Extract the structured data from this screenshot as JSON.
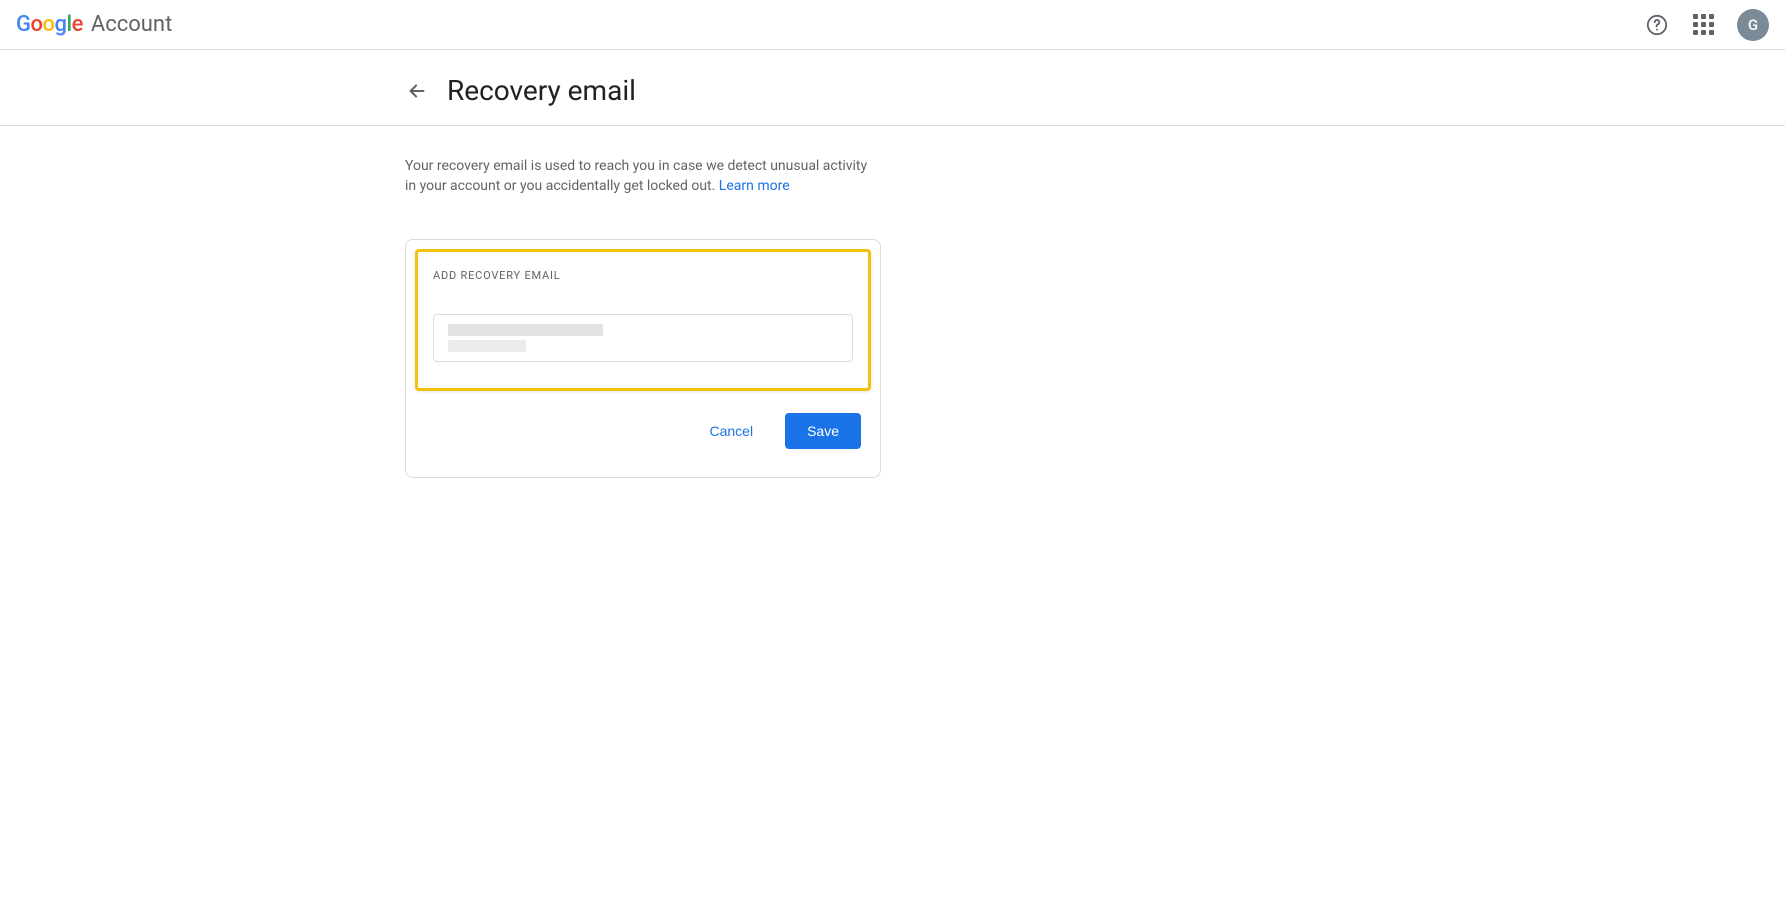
{
  "header": {
    "product": "Account",
    "avatar_initial": "G",
    "logo_colors": {
      "g1": "#4285F4",
      "o1": "#EA4335",
      "o2": "#FBBC05",
      "g2": "#4285F4",
      "l": "#34A853",
      "e": "#EA4335"
    }
  },
  "page": {
    "title": "Recovery email",
    "description": "Your recovery email is used to reach you in case we detect unusual activity in your account or you accidentally get locked out. ",
    "learn_more": "Learn more"
  },
  "form": {
    "label": "ADD RECOVERY EMAIL",
    "value": "",
    "cancel": "Cancel",
    "save": "Save"
  },
  "colors": {
    "accent": "#1a73e8",
    "highlight": "#f4c20d"
  }
}
